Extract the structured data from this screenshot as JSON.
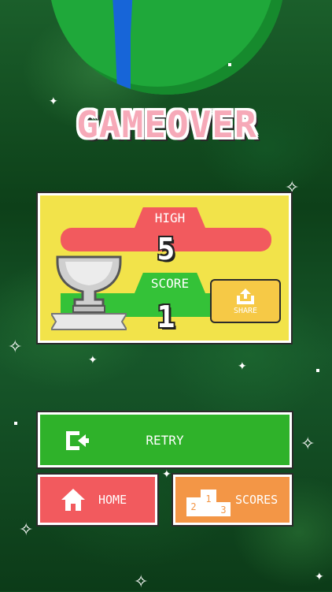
{
  "title": "GAMEOVER",
  "high": {
    "label": "HIGH",
    "value": "5"
  },
  "score": {
    "label": "SCORE",
    "value": "1"
  },
  "buttons": {
    "share": "SHARE",
    "retry": "RETRY",
    "home": "HOME",
    "scores": "SCORES"
  },
  "icons": {
    "trophy": "trophy-icon",
    "share": "share-icon",
    "retry": "retry-icon",
    "home": "home-icon",
    "scores": "podium-icon"
  },
  "colors": {
    "high": "#f25a5e",
    "score": "#34c238",
    "panel": "#f2e34a",
    "share": "#f6c946",
    "retry": "#2fb22a",
    "home": "#f25a5e",
    "scores": "#f39646",
    "title": "#f6a9b8"
  }
}
